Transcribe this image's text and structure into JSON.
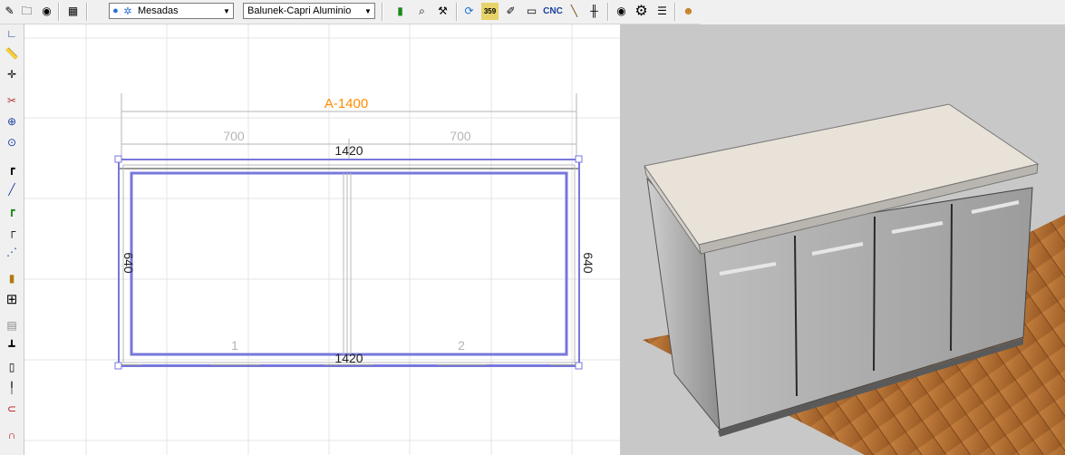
{
  "toolbar": {
    "icons": [
      "pencil-icon",
      "open-icon",
      "camera-icon",
      "calculator-icon",
      "bulb-icon",
      "settings-icon",
      "book-icon",
      "zoom-icon",
      "tools-icon",
      "refresh-icon",
      "badge-icon",
      "brush-icon",
      "frame-icon",
      "cnc-icon",
      "line-icon",
      "column-icon",
      "camera-icon",
      "gear-icon",
      "list-icon",
      "people-icon"
    ],
    "category_value": "Mesadas",
    "material_value": "Balunek-Capri Aluminio",
    "cnc_label": "CNC"
  },
  "left_toolbar": {
    "icons": [
      "axis-icon",
      "ruler-icon",
      "crosshair-icon",
      "cursor-icon",
      "zoom-in-icon",
      "zoom-icon",
      "corner-icon",
      "line-icon",
      "corner-green-icon",
      "dotted-corner-icon",
      "dotted-line-icon",
      "panel-icon",
      "grid-icon",
      "drawer-icon",
      "leg-icon",
      "door-icon",
      "handle-icon",
      "magnet-icon",
      "red-magnet-icon"
    ]
  },
  "drawing": {
    "module_label": "A-1400",
    "dim_left_700": "700",
    "dim_right_700": "700",
    "width_top": "1420",
    "width_bottom": "1420",
    "depth_left": "640",
    "depth_right": "640",
    "bay_1": "1",
    "bay_2": "2",
    "colors": {
      "module": "#ff8c00",
      "outline": "#7777dd",
      "grid": "#e4e4e4"
    }
  },
  "view3d": {
    "colors": {
      "background": "#c8c8c8",
      "floor": "#b8743c",
      "cabinet": "#a8a8a8",
      "countertop": "#e6e0d6"
    }
  }
}
